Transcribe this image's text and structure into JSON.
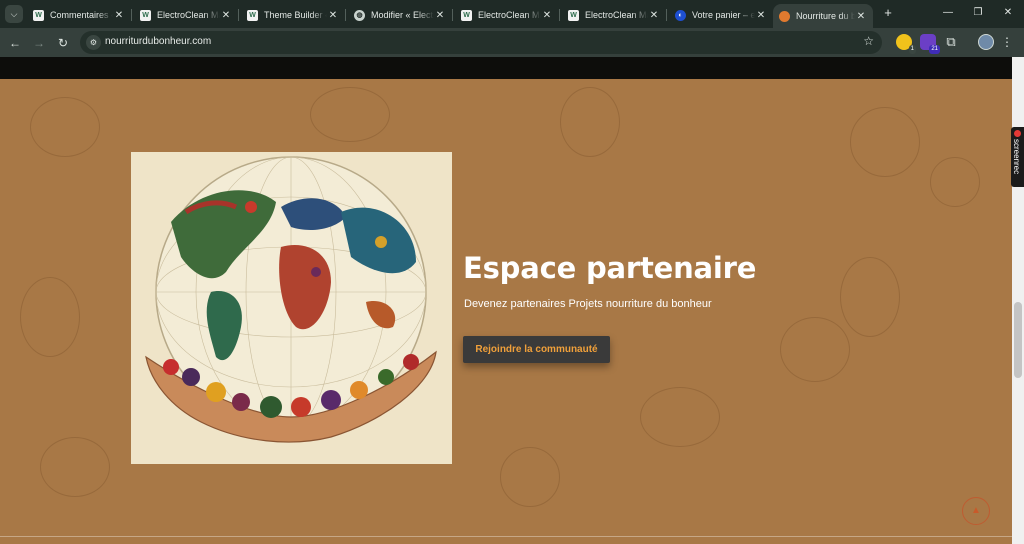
{
  "browser": {
    "tabs": [
      {
        "label": "Commentaires ‹",
        "favicon": "wordpress-icon",
        "active": false
      },
      {
        "label": "ElectroClean Ma",
        "favicon": "wordpress-icon",
        "active": false
      },
      {
        "label": "Theme Builder ‹",
        "favicon": "wordpress-icon",
        "active": false
      },
      {
        "label": "Modifier « Electr",
        "favicon": "globe-icon",
        "active": false
      },
      {
        "label": "ElectroClean Ma",
        "favicon": "wordpress-icon",
        "active": false
      },
      {
        "label": "ElectroClean Ma",
        "favicon": "wordpress-icon",
        "active": false
      },
      {
        "label": "Votre panier – el",
        "favicon": "blue-circle-icon",
        "active": false
      },
      {
        "label": "Nourriture du bo",
        "favicon": "food-icon",
        "active": true
      }
    ],
    "url": "nourriturdubonheur.com",
    "extensions": {
      "badge_1": "1",
      "badge_2": "21"
    },
    "screenrec_label": "screenrec"
  },
  "page": {
    "hero": {
      "title": "Espace partenaire",
      "subtitle": "Devenez partenaires Projets nourriture du bonheur",
      "cta_label": "Rejoindre la communauté"
    }
  },
  "colors": {
    "page_background": "#a87846",
    "header_strip": "#0d0d0b",
    "button_background": "#3a3a3a",
    "button_text": "#f0a03a",
    "browser_frame": "#1f2a26",
    "toolbar": "#35403c"
  }
}
